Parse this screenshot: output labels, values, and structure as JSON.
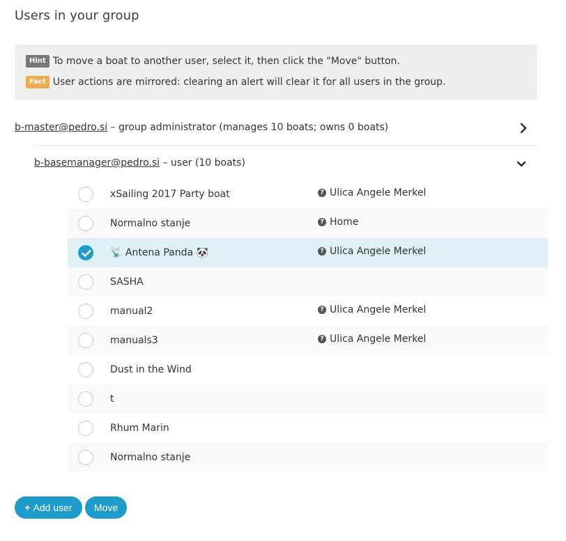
{
  "page": {
    "title": "Users in your group"
  },
  "info": {
    "hint_badge": "Hint",
    "hint_text": "To move a boat to another user, select it, then click the \"Move\" button.",
    "fact_badge": "Fact",
    "fact_text": "User actions are mirrored: clearing an alert will clear it for all users in the group."
  },
  "users": {
    "admin": {
      "email": "b-master@pedro.si",
      "desc": " – group administrator (manages 10 boats; owns 0 boats)",
      "expanded": false
    },
    "manager": {
      "email": "b-basemanager@pedro.si",
      "desc": " – user (10 boats)",
      "expanded": true
    }
  },
  "boats": [
    {
      "name": "xSailing 2017 Party boat",
      "location": "Ulica Angele Merkel",
      "selected": false
    },
    {
      "name": "Normalno stanje",
      "location": "Home",
      "selected": false
    },
    {
      "name": "📡 Antena Panda 🐼",
      "location": "Ulica Angele Merkel",
      "selected": true
    },
    {
      "name": "SASHA",
      "location": "",
      "selected": false
    },
    {
      "name": "manual2",
      "location": "Ulica Angele Merkel",
      "selected": false
    },
    {
      "name": "manuals3",
      "location": "Ulica Angele Merkel",
      "selected": false
    },
    {
      "name": "Dust in the Wind",
      "location": "",
      "selected": false
    },
    {
      "name": "t",
      "location": "",
      "selected": false
    },
    {
      "name": "Rhum Marin",
      "location": "",
      "selected": false
    },
    {
      "name": "Normalno stanje",
      "location": "",
      "selected": false
    }
  ],
  "actions": {
    "add_user": "Add user",
    "move": "Move"
  },
  "colors": {
    "accent": "#1f9bc9",
    "selected_row": "#dff0f7",
    "hint_badge": "#777777",
    "fact_badge": "#f0ad4e"
  }
}
